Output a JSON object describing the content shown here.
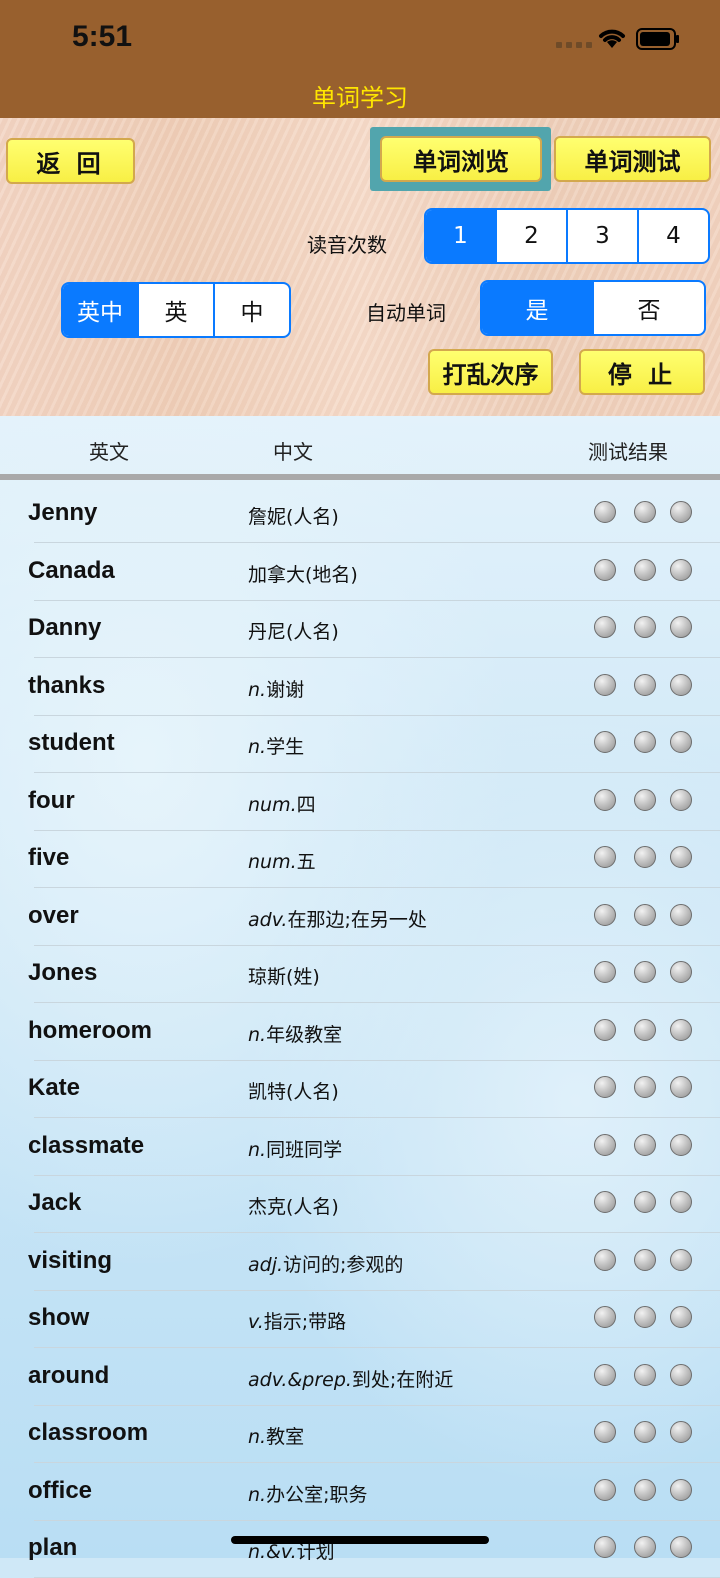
{
  "status": {
    "time": "5:51"
  },
  "nav": {
    "title": "单词学习"
  },
  "controls": {
    "back": "返 回",
    "browse": "单词浏览",
    "test": "单词测试",
    "read_count_label": "读音次数",
    "read_counts": [
      "1",
      "2",
      "3",
      "4"
    ],
    "lang_modes": [
      "英中",
      "英",
      "中"
    ],
    "auto_label": "自动单词",
    "auto_options": [
      "是",
      "否"
    ],
    "shuffle": "打乱次序",
    "stop": "停 止"
  },
  "table": {
    "headers": {
      "en": "英文",
      "cn": "中文",
      "result": "测试结果"
    },
    "rows": [
      {
        "en": "Jenny",
        "pos": "",
        "cn": "詹妮(人名)"
      },
      {
        "en": "Canada",
        "pos": "",
        "cn": "加拿大(地名)"
      },
      {
        "en": "Danny",
        "pos": "",
        "cn": "丹尼(人名)"
      },
      {
        "en": "thanks",
        "pos": "n.",
        "cn": "谢谢"
      },
      {
        "en": "student",
        "pos": "n.",
        "cn": "学生"
      },
      {
        "en": "four",
        "pos": "num.",
        "cn": "四"
      },
      {
        "en": "five",
        "pos": "num.",
        "cn": "五"
      },
      {
        "en": "over",
        "pos": "adv.",
        "cn": "在那边;在另一处"
      },
      {
        "en": "Jones",
        "pos": "",
        "cn": "琼斯(姓)"
      },
      {
        "en": "homeroom",
        "pos": "n.",
        "cn": "年级教室"
      },
      {
        "en": "Kate",
        "pos": "",
        "cn": "凯特(人名)"
      },
      {
        "en": "classmate",
        "pos": "n.",
        "cn": "同班同学"
      },
      {
        "en": "Jack",
        "pos": "",
        "cn": "杰克(人名)"
      },
      {
        "en": "visiting",
        "pos": "adj.",
        "cn": "访问的;参观的"
      },
      {
        "en": "show",
        "pos": "v.",
        "cn": "指示;带路"
      },
      {
        "en": "around",
        "pos": "adv.&prep.",
        "cn": "到处;在附近"
      },
      {
        "en": "classroom",
        "pos": "n.",
        "cn": "教室"
      },
      {
        "en": "office",
        "pos": "n.",
        "cn": "办公室;职务"
      },
      {
        "en": "plan",
        "pos": "n.&v.",
        "cn": "计划"
      }
    ]
  }
}
